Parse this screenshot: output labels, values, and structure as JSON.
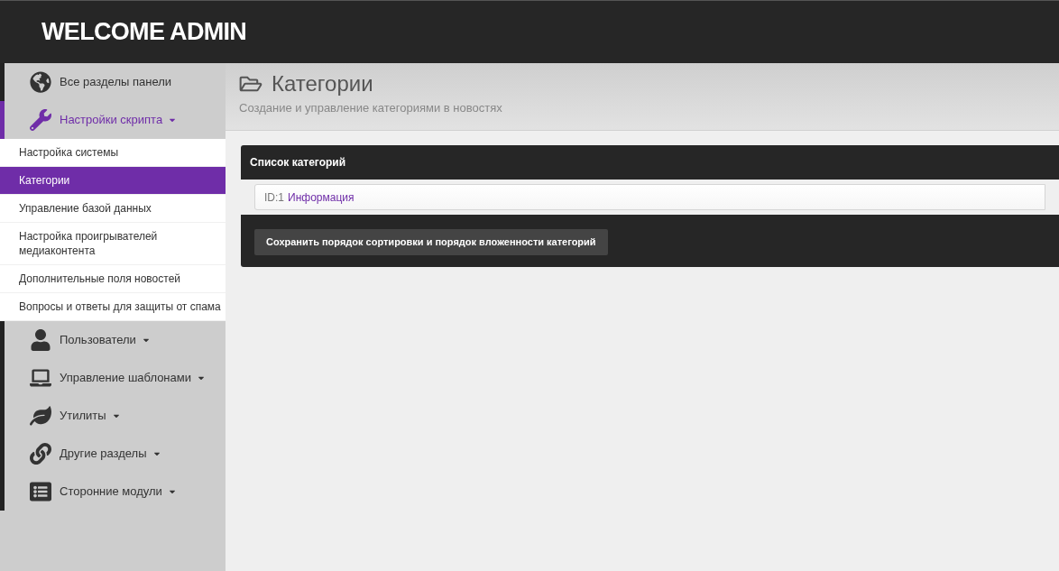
{
  "header": {
    "title": "WELCOME ADMIN"
  },
  "sidebar": {
    "items": [
      {
        "label": "Все разделы панели",
        "has_caret": false,
        "selected": false
      },
      {
        "label": "Настройки скрипта",
        "has_caret": true,
        "selected": true,
        "expanded": true,
        "children": [
          {
            "label": "Настройка системы",
            "selected": false
          },
          {
            "label": "Категории",
            "selected": true
          },
          {
            "label": "Управление базой данных",
            "selected": false
          },
          {
            "label": "Настройка проигрывателей медиаконтента",
            "selected": false
          },
          {
            "label": "Дополнительные поля новостей",
            "selected": false
          },
          {
            "label": "Вопросы и ответы для защиты от спама",
            "selected": false
          }
        ]
      },
      {
        "label": "Пользователи",
        "has_caret": true,
        "selected": false,
        "expanded": false
      },
      {
        "label": "Управление шаблонами",
        "has_caret": true,
        "selected": false,
        "expanded": false
      },
      {
        "label": "Утилиты",
        "has_caret": true,
        "selected": false,
        "expanded": false
      },
      {
        "label": "Другие разделы",
        "has_caret": true,
        "selected": false,
        "expanded": false
      },
      {
        "label": "Сторонние модули",
        "has_caret": true,
        "selected": false,
        "expanded": false
      }
    ]
  },
  "page_header": {
    "title": "Категории",
    "subtitle": "Создание и управление категориями в новостях"
  },
  "panel": {
    "title": "Список категорий",
    "categories": [
      {
        "id": "ID:1",
        "name": "Информация"
      }
    ],
    "save_button": "Сохранить порядок сортировки и порядок вложенности категорий"
  }
}
